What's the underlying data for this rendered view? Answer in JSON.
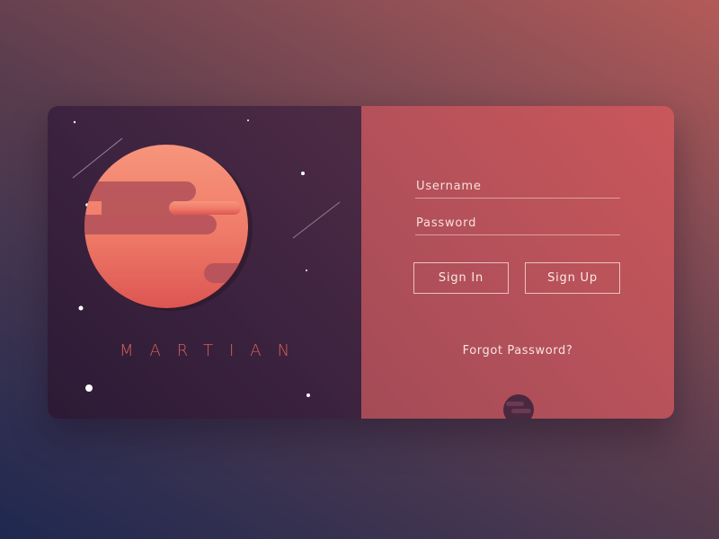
{
  "brand": {
    "title": "MARTIAN"
  },
  "login_form": {
    "username_label": "Username",
    "password_label": "Password",
    "sign_in_label": "Sign In",
    "sign_up_label": "Sign Up",
    "forgot_password_label": "Forgot Password?"
  },
  "colors": {
    "brand_text": "#d85f58",
    "planet_top": "#f6907a",
    "planet_bottom": "#dd5a53",
    "left_panel": "#3a223e",
    "right_panel": "#b8525a"
  },
  "icons": {
    "planet": "planet-illustration",
    "mini_planet": "mini-planet-icon"
  }
}
